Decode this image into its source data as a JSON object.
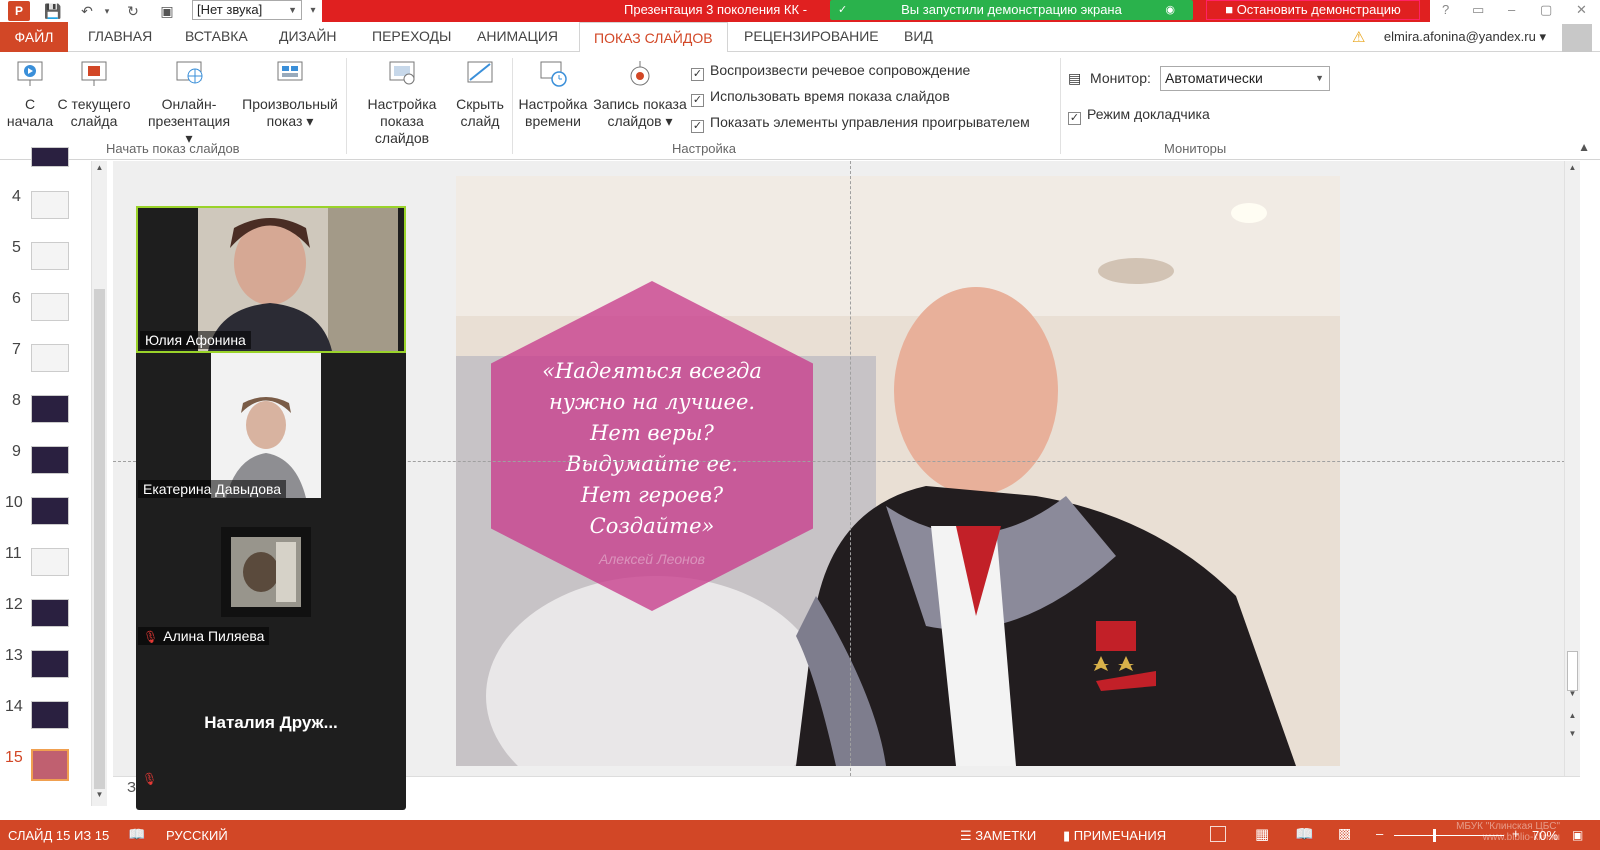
{
  "titlebar": {
    "app_icon_label": "P",
    "sound_select_value": "[Нет звука]",
    "window_title": "Презентация 3 поколения КК -",
    "share_notice": "Вы запустили демонстрацию экрана",
    "stop_share_label": "Остановить демонстрацию",
    "window_controls": [
      "?",
      "▭",
      "–",
      "▢",
      "✕"
    ]
  },
  "tabs": {
    "file": "ФАЙЛ",
    "items": [
      "ГЛАВНАЯ",
      "ВСТАВКА",
      "ДИЗАЙН",
      "ПЕРЕХОДЫ",
      "АНИМАЦИЯ",
      "ПОКАЗ СЛАЙДОВ",
      "РЕЦЕНЗИРОВАНИЕ",
      "ВИД"
    ],
    "active": "ПОКАЗ СЛАЙДОВ",
    "account": "elmira.afonina@yandex.ru"
  },
  "ribbon": {
    "start_group": {
      "label": "Начать показ слайдов",
      "buttons": [
        {
          "line1": "С",
          "line2": "начала"
        },
        {
          "line1": "С текущего",
          "line2": "слайда"
        },
        {
          "line1": "Онлайн-",
          "line2": "презентация ▾"
        },
        {
          "line1": "Произвольный",
          "line2": "показ ▾"
        }
      ]
    },
    "setup_group": {
      "label": "Настройка",
      "buttons": [
        {
          "line1": "Настройка",
          "line2": "показа слайдов"
        },
        {
          "line1": "Скрыть",
          "line2": "слайд"
        },
        {
          "line1": "Настройка",
          "line2": "времени"
        },
        {
          "line1": "Запись показа",
          "line2": "слайдов ▾"
        }
      ],
      "checkboxes": [
        {
          "label": "Воспроизвести речевое сопровождение",
          "checked": true
        },
        {
          "label": "Использовать время показа слайдов",
          "checked": true
        },
        {
          "label": "Показать элементы управления проигрывателем",
          "checked": true
        }
      ]
    },
    "monitors_group": {
      "label": "Мониторы",
      "monitor_label": "Монитор:",
      "monitor_value": "Автоматически",
      "presenter_view_label": "Режим докладчика",
      "presenter_view_checked": true
    }
  },
  "thumbnails": {
    "numbers": [
      "4",
      "5",
      "6",
      "7",
      "8",
      "9",
      "10",
      "11",
      "12",
      "13",
      "14",
      "15"
    ],
    "active": "15"
  },
  "slide": {
    "quote_lines": [
      "«Надеяться всегда",
      "нужно на лучшее.",
      "Нет веры?",
      "Выдумайте ее.",
      "Нет героев?",
      "Создайте»"
    ],
    "author": "Алексей Леонов"
  },
  "video_panel": {
    "participants": [
      {
        "name": "Юлия Афонина",
        "muted": false,
        "active_speaker": true
      },
      {
        "name": "Екатерина Давыдова",
        "muted": false
      },
      {
        "name": "Алина Пиляева",
        "muted": true
      },
      {
        "name": "Наталия  Друж...",
        "muted": true
      }
    ]
  },
  "notes_stub": "З",
  "statusbar": {
    "slide_counter": "СЛАЙД 15 ИЗ 15",
    "language": "РУССКИЙ",
    "notes": "ЗАМЕТКИ",
    "comments": "ПРИМЕЧАНИЯ",
    "zoom": "70%",
    "zoom_level_fraction": 0.35,
    "watermark_line1": "МБУК \"Клинская ЦБС\"",
    "watermark_line2": "www.biblio-klin.ru"
  },
  "colors": {
    "brand": "#d24726",
    "zoom_red": "#e02020",
    "share_green": "#2ab24c",
    "active_speaker": "#9ad32a",
    "hex_magenta": "#c83c8c"
  }
}
